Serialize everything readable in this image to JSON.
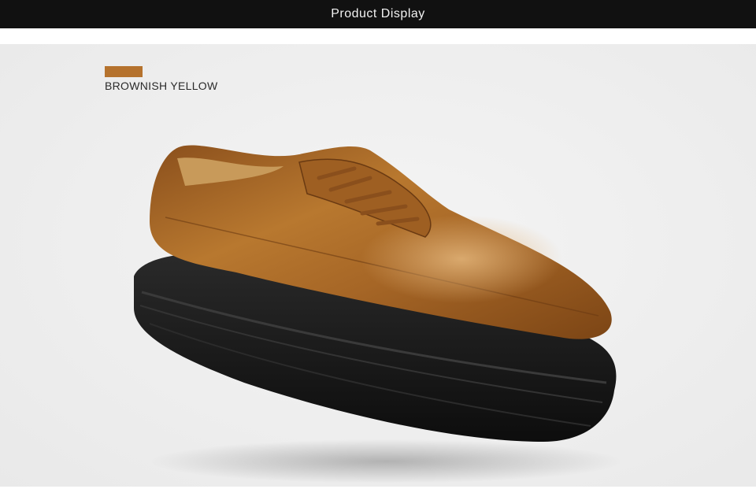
{
  "header": {
    "title": "Product Display"
  },
  "product": {
    "color_name": "BROWNISH YELLOW",
    "swatch_color": "#b5722d",
    "image_icon": "shoe-image"
  },
  "colors": {
    "header_bg": "#111111",
    "page_bg": "#eeeeee",
    "leather": "#a9672a",
    "sole": "#141414"
  }
}
